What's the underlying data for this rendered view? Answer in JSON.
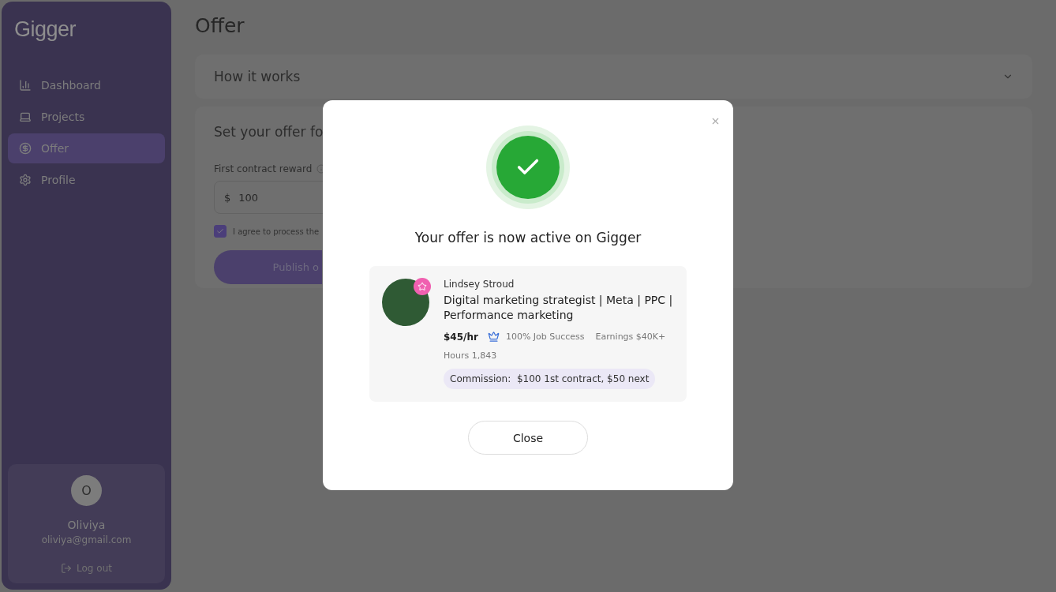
{
  "sidebar": {
    "logo": "Gigger",
    "items": [
      {
        "label": "Dashboard",
        "selected": false
      },
      {
        "label": "Projects",
        "selected": false
      },
      {
        "label": "Offer",
        "selected": true
      },
      {
        "label": "Profile",
        "selected": false
      }
    ],
    "user": {
      "initial": "O",
      "name": "Oliviya",
      "email": "oliviya@gmail.com",
      "logout": "Log out"
    }
  },
  "page": {
    "title": "Offer",
    "accordion": {
      "title": "How it works",
      "expanded": false
    },
    "form": {
      "heading": "Set your offer fo",
      "field_label": "First contract reward",
      "currency": "$",
      "value": "100",
      "agree": {
        "label": "I agree to process the",
        "checked": true
      },
      "submit": "Publish o"
    }
  },
  "modal": {
    "title": "Your offer is now active on Gigger",
    "profile": {
      "name": "Lindsey Stroud",
      "headline": "Digital marketing strategist | Meta | PPC | Performance marketing",
      "rate": "$45/hr",
      "job_success": "100% Job Success",
      "earnings": "Earnings $40K+",
      "hours": "Hours 1,843",
      "commission": "Commission:  $100 1st contract, $50 next"
    },
    "close": "Close"
  }
}
